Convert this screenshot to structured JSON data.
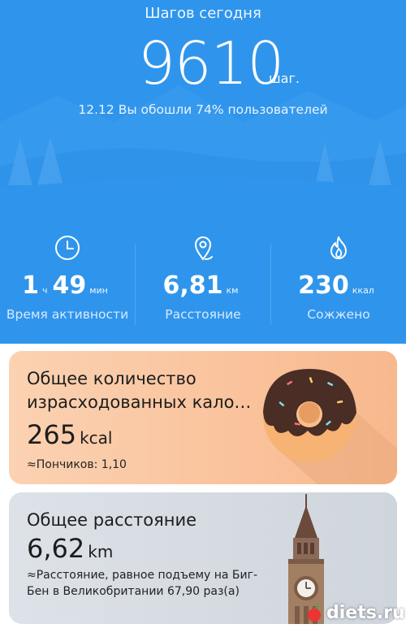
{
  "header": {
    "title": "Шагов сегодня",
    "steps": "9610",
    "steps_unit": "шаг.",
    "comparison": "12.12 Вы обошли 74% пользователей"
  },
  "stats": {
    "active": {
      "icon": "clock-icon",
      "hours": "1",
      "hours_unit": "ч",
      "minutes": "49",
      "minutes_unit": "мин",
      "label": "Время активности"
    },
    "distance": {
      "icon": "location-pin-icon",
      "value": "6,81",
      "unit": "км",
      "label": "Расстояние"
    },
    "burned": {
      "icon": "flame-icon",
      "value": "230",
      "unit": "ккал",
      "label": "Сожжено"
    }
  },
  "cards": {
    "calories": {
      "title": "Общее количество израсходованных кало…",
      "value": "265",
      "unit": "kcal",
      "note": "≈Пончиков: 1,10",
      "illustration": "donut"
    },
    "distance": {
      "title": "Общее расстояние",
      "value": "6,62",
      "unit": "km",
      "note": "≈Расстояние, равное подъему на Биг-Бен в Великобритании 67,90 раз(а)",
      "illustration": "big-ben"
    }
  },
  "watermark": {
    "text": "diets.ru"
  },
  "colors": {
    "hero": "#2f95ec",
    "card_calories": "#f9c29c",
    "card_distance": "#d7dce2"
  }
}
